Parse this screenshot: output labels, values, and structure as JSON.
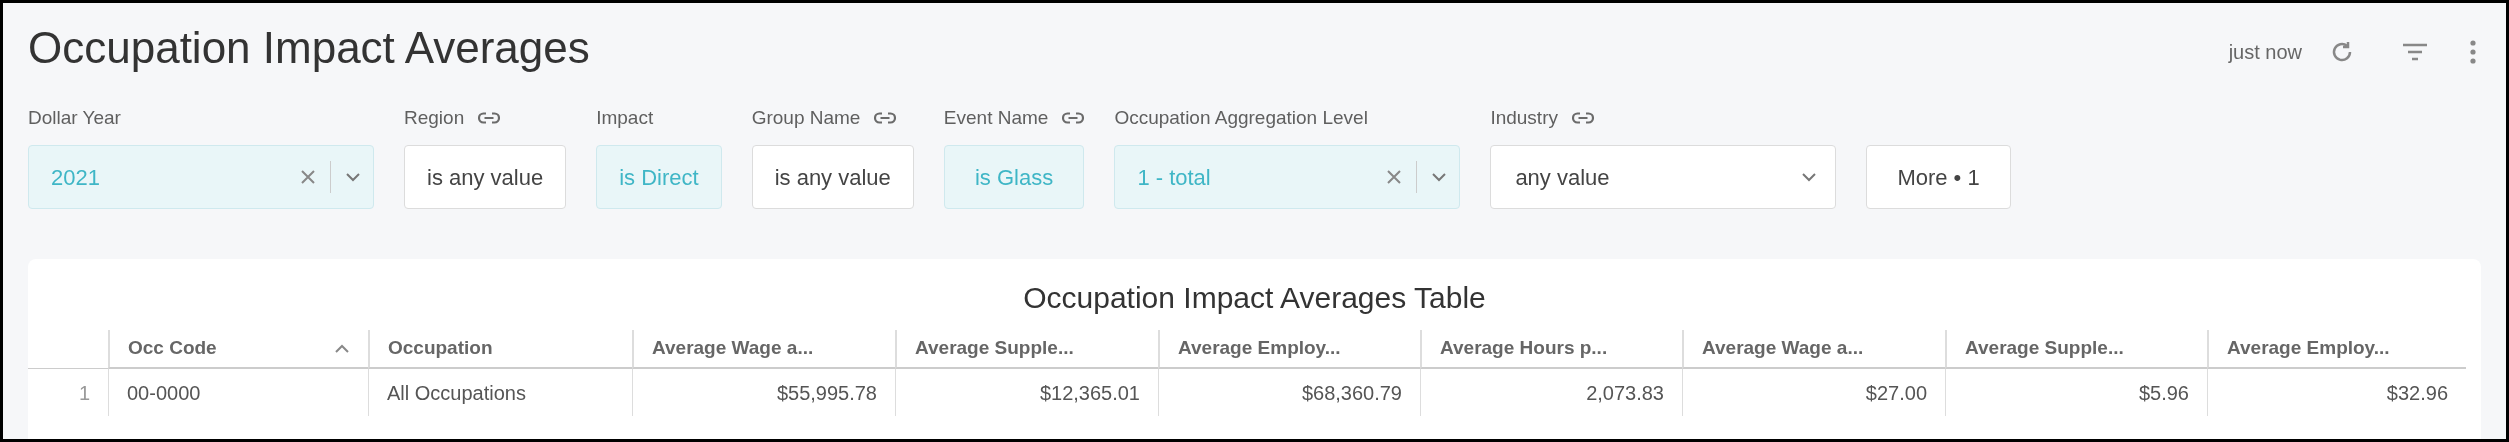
{
  "title": "Occupation Impact Averages",
  "header": {
    "updated": "just now"
  },
  "filters": [
    {
      "label": "Dollar Year",
      "linked": false,
      "kind": "select",
      "value": "2021",
      "active": true
    },
    {
      "label": "Region",
      "linked": true,
      "kind": "chip",
      "value": "is any value",
      "active": false
    },
    {
      "label": "Impact",
      "linked": false,
      "kind": "chip",
      "value": "is Direct",
      "active": true
    },
    {
      "label": "Group Name",
      "linked": true,
      "kind": "chip",
      "value": "is any value",
      "active": false
    },
    {
      "label": "Event Name",
      "linked": true,
      "kind": "chip",
      "value": "is Glass",
      "active": true
    },
    {
      "label": "Occupation Aggregation Level",
      "linked": false,
      "kind": "select",
      "value": "1 - total",
      "active": true
    },
    {
      "label": "Industry",
      "linked": true,
      "kind": "dropdown",
      "value": "any value",
      "active": false
    },
    {
      "kind": "button",
      "value": "More • 1",
      "active": false
    }
  ],
  "table": {
    "title": "Occupation Impact Averages Table",
    "columns": [
      {
        "label": "Occ Code",
        "sorted": true
      },
      {
        "label": "Occupation",
        "sorted": false
      },
      {
        "label": "Average Wage a...",
        "sorted": false
      },
      {
        "label": "Average Supple...",
        "sorted": false
      },
      {
        "label": "Average Employ...",
        "sorted": false
      },
      {
        "label": "Average Hours p...",
        "sorted": false
      },
      {
        "label": "Average Wage a...",
        "sorted": false
      },
      {
        "label": "Average Supple...",
        "sorted": false
      },
      {
        "label": "Average Employ...",
        "sorted": false
      }
    ],
    "rows": [
      {
        "number": "1",
        "cells": [
          "00-0000",
          "All Occupations",
          "$55,995.78",
          "$12,365.01",
          "$68,360.79",
          "2,073.83",
          "$27.00",
          "$5.96",
          "$32.96"
        ]
      }
    ]
  }
}
